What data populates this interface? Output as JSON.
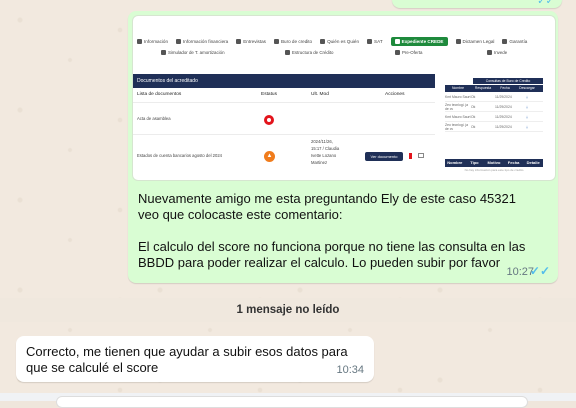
{
  "outgoing": {
    "screenshot": {
      "nav_row1": [
        {
          "label": "Información",
          "icon": "info-icon"
        },
        {
          "label": "Información financiera",
          "icon": "finance-icon"
        },
        {
          "label": "Entrevistas",
          "icon": "people-icon"
        },
        {
          "label": "Buro de credito",
          "icon": "globe-icon"
        },
        {
          "label": "Quién es Quién",
          "icon": "arrows-icon"
        },
        {
          "label": "SAT",
          "icon": "sat-icon"
        },
        {
          "label": "Expediente CREDE",
          "icon": "folder-icon",
          "active": true
        },
        {
          "label": "Dictamen Legal",
          "icon": "gavel-icon"
        },
        {
          "label": "Garantía",
          "icon": "bank-icon"
        }
      ],
      "nav_row2": [
        {
          "label": "Simulador de T. amortización",
          "icon": "calc-icon"
        },
        {
          "label": "Estructura de Crédito",
          "icon": "structure-icon"
        },
        {
          "label": "Pre-Oferta",
          "icon": "doc-icon"
        },
        {
          "label": "Invede",
          "icon": "shield-icon"
        }
      ],
      "docs_title": "Documentos del acreditado",
      "columns": {
        "doc": "Lista de documentos",
        "status": "Estatus",
        "mod": "Ult. Mod",
        "actions": "Acciones"
      },
      "rows": [
        {
          "doc": "Acta de asamblea",
          "status": "missing",
          "mod": ""
        },
        {
          "doc": "Estados de cuenta bancarios agosto del 2024",
          "status": "warning",
          "mod_line1": "2024/11/26,",
          "mod_line2": "15:17 / Claudia",
          "mod_line3": "Ivette Lozano",
          "mod_line4": "Martinez",
          "button": "Ver documento"
        }
      ],
      "credit_title": "Consultas de Buro de Credito",
      "credit_headers": [
        "Nombre",
        "Respuesta",
        "Fecha",
        "Descargar Excel"
      ],
      "credit_rows": [
        {
          "name": "Kmt Mauro Saurt",
          "resp": "Ok",
          "date": "11/29/2024"
        },
        {
          "name": "Zeo tecnlogi. ja de cv",
          "resp": "Ok",
          "date": "11/29/2024"
        },
        {
          "name": "Kmt Mauro Saurt",
          "resp": "Ok",
          "date": "11/29/2024"
        },
        {
          "name": "Zeo tecnlogi. ja de cv",
          "resp": "Ok",
          "date": "11/29/2024"
        }
      ],
      "credit2_headers": [
        "Nombre",
        "Tipo",
        "Motivo",
        "Fecha",
        "Detalle"
      ],
      "credit2_nodata": "No hay información para este tipo de crédito"
    },
    "text_line1": "Nuevamente amigo me esta preguntando Ely de este caso 45321",
    "text_line2": "veo que colocaste este comentario:",
    "text_line3": "El calculo del score no funciona porque no tiene las consulta en las",
    "text_line4": "BBDD para poder realizar el calculo. Lo pueden subir por favor",
    "time": "10:27",
    "read_icon": "double-check-icon",
    "read_color": "#53bdeb"
  },
  "unread_banner": "1 mensaje no leído",
  "incoming": {
    "text_line1": "Correcto, me tienen que ayudar a subir esos datos para",
    "text_line2": "que se calculé el score",
    "time": "10:34"
  },
  "colors": {
    "outgoing_bubble": "#d9fdd3",
    "incoming_bubble": "#ffffff",
    "nav_active": "#1e8a3c",
    "header_navy": "#1f2f57"
  }
}
